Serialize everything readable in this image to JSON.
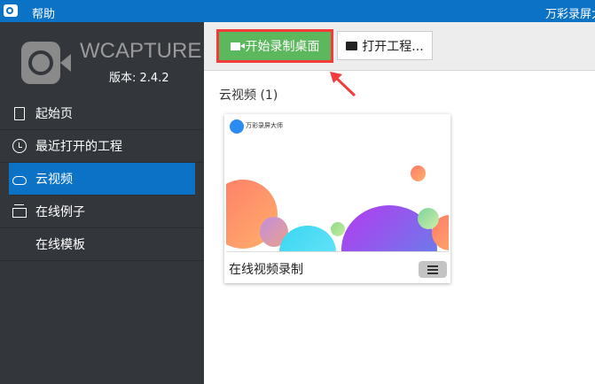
{
  "titlebar": {
    "menu_help": "帮助",
    "title": "万彩录屏大"
  },
  "sidebar": {
    "brand": "WCAPTURE",
    "version": "版本: 2.4.2",
    "items": [
      {
        "label": "起始页",
        "icon": "page-icon"
      },
      {
        "label": "最近打开的工程",
        "icon": "clock-icon"
      },
      {
        "label": "云视频",
        "icon": "cloud-icon",
        "active": true
      },
      {
        "label": "在线例子",
        "icon": "folder-icon"
      },
      {
        "label": "在线模板",
        "icon": ""
      }
    ]
  },
  "toolbar": {
    "record_label": "开始录制桌面",
    "open_label": "打开工程..."
  },
  "main": {
    "section_title": "云视频 (1)",
    "cards": [
      {
        "title": "在线视频录制",
        "thumb_text": "万彩录屏大师"
      }
    ]
  },
  "colors": {
    "accent": "#0b72c5",
    "record_green": "#5cb85c",
    "highlight_red": "#f23b3b",
    "sidebar_bg": "#33373b"
  }
}
